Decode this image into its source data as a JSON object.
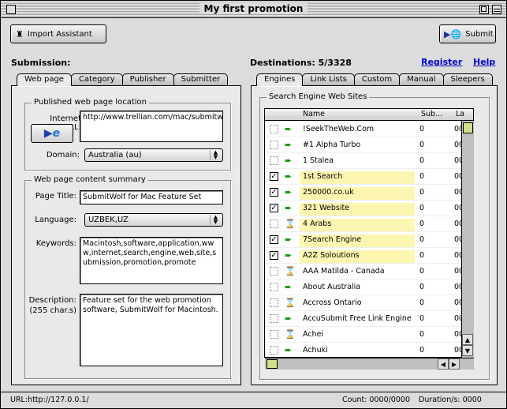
{
  "window": {
    "title": "My first promotion"
  },
  "toolbar": {
    "import_label": "Import Assistant",
    "submit_label": "Submit"
  },
  "submission": {
    "heading": "Submission:",
    "tabs": [
      "Web page",
      "Category",
      "Publisher",
      "Submitter"
    ],
    "location_group": "Published web page location",
    "internet_url_label": "Internet URL:",
    "internet_url_value": "http://www.trellian.com/mac/submitwolf/index.html",
    "domain_label": "Domain:",
    "domain_value": "Australia (au)",
    "summary_group": "Web page content summary",
    "page_title_label": "Page Title:",
    "page_title_value": "SubmitWolf for Mac Feature Set",
    "language_label": "Language:",
    "language_value": "UZBEK,UZ",
    "keywords_label": "Keywords:",
    "keywords_value": "Macintosh,software,application,www,internet,search,engine,web,site,submission,promotion,promote",
    "description_label": "Description:",
    "description_sub": "(255 char.s)",
    "description_value": "Feature set for the web promotion software, SubmitWolf for Macintosh."
  },
  "destinations": {
    "heading": "Destinations:  5/3328",
    "register_link": "Register",
    "help_link": "Help",
    "tabs": [
      "Engines",
      "Link Lists",
      "Custom",
      "Manual",
      "Sleepers"
    ],
    "group_title": "Search Engine Web Sites",
    "columns": {
      "name": "Name",
      "sub": "Sub...",
      "last": "La"
    },
    "rows": [
      {
        "checked": false,
        "status": "arrow",
        "name": "!SeekTheWeb.Com",
        "sub": "0",
        "last": "00",
        "highlight": false
      },
      {
        "checked": false,
        "status": "arrow",
        "name": "#1 Alpha Turbo",
        "sub": "0",
        "last": "00",
        "highlight": false
      },
      {
        "checked": false,
        "status": "arrow",
        "name": "1 Stalea",
        "sub": "0",
        "last": "00",
        "highlight": false
      },
      {
        "checked": true,
        "status": "arrow",
        "name": "1st Search",
        "sub": "0",
        "last": "00",
        "highlight": true
      },
      {
        "checked": true,
        "status": "arrow",
        "name": "250000.co.uk",
        "sub": "0",
        "last": "00",
        "highlight": true
      },
      {
        "checked": true,
        "status": "arrow",
        "name": "321 Website",
        "sub": "0",
        "last": "00",
        "highlight": true
      },
      {
        "checked": false,
        "status": "hourglass",
        "name": "4 Arabs",
        "sub": "0",
        "last": "00",
        "highlight": true
      },
      {
        "checked": true,
        "status": "arrow",
        "name": "7Search Engine",
        "sub": "0",
        "last": "00",
        "highlight": true
      },
      {
        "checked": true,
        "status": "arrow",
        "name": "A2Z Soloutions",
        "sub": "0",
        "last": "00",
        "highlight": true
      },
      {
        "checked": false,
        "status": "hourglass",
        "name": "AAA Matilda - Canada",
        "sub": "0",
        "last": "00",
        "highlight": false
      },
      {
        "checked": false,
        "status": "arrow",
        "name": "About Australia",
        "sub": "0",
        "last": "00",
        "highlight": false
      },
      {
        "checked": false,
        "status": "hourglass",
        "name": "Accross Ontario",
        "sub": "0",
        "last": "00",
        "highlight": false
      },
      {
        "checked": false,
        "status": "arrow",
        "name": "AccuSubmit Free Link Engine",
        "sub": "0",
        "last": "00",
        "highlight": false
      },
      {
        "checked": false,
        "status": "hourglass",
        "name": "Achei",
        "sub": "0",
        "last": "00",
        "highlight": false
      },
      {
        "checked": false,
        "status": "arrow",
        "name": "Achuki",
        "sub": "0",
        "last": "00",
        "highlight": false
      }
    ]
  },
  "status": {
    "url": "URL:http://127.0.0.1/",
    "count": "Count:  0000/0000",
    "duration": "Duration/s:  0000"
  },
  "colors": {
    "highlight": "#fdf6b0",
    "link": "#0000cc",
    "scroll_thumb": "#cde28a",
    "arrow_green": "#1a9a1a"
  }
}
